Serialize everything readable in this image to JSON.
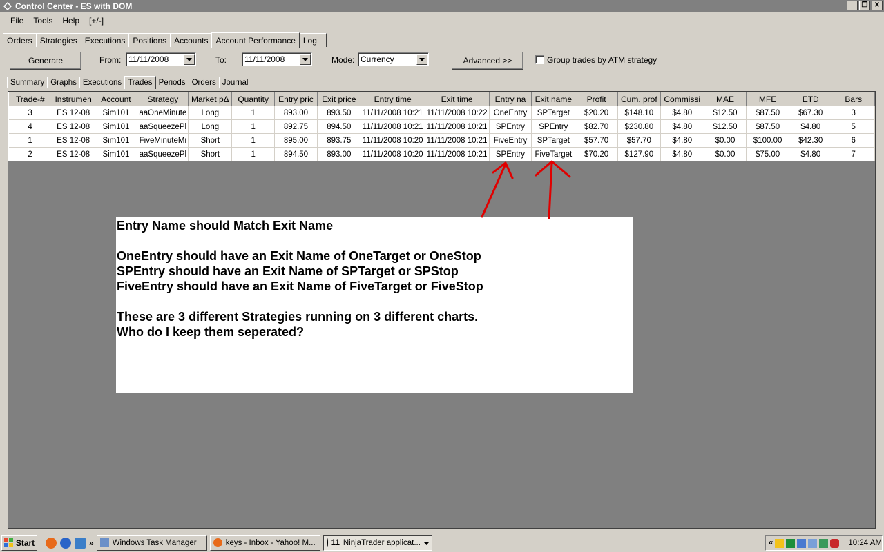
{
  "window": {
    "title": "Control Center - ES with DOM",
    "minimize": "_",
    "restore": "❐",
    "close": "✕"
  },
  "menu": [
    "File",
    "Tools",
    "Help",
    "[+/-]"
  ],
  "main_tabs": [
    "Orders",
    "Strategies",
    "Executions",
    "Positions",
    "Accounts",
    "Account Performance",
    "Log"
  ],
  "toolbar": {
    "generate": "Generate",
    "from_label": "From:",
    "from_value": "11/11/2008",
    "to_label": "To:",
    "to_value": "11/11/2008",
    "mode_label": "Mode:",
    "mode_value": "Currency",
    "advanced": "Advanced >>",
    "group_label": "Group trades by ATM strategy"
  },
  "sub_tabs": [
    "Summary",
    "Graphs",
    "Executions",
    "Trades",
    "Periods",
    "Orders",
    "Journal"
  ],
  "table": {
    "columns": [
      "Trade-#",
      "Instrumen",
      "Account",
      "Strategy",
      "Market pΔ",
      "Quantity",
      "Entry pric",
      "Exit price",
      "Entry time",
      "Exit time",
      "Entry na",
      "Exit name",
      "Profit",
      "Cum. prof",
      "Commissi",
      "MAE",
      "MFE",
      "ETD",
      "Bars"
    ],
    "rows": [
      [
        "3",
        "ES 12-08",
        "Sim101",
        "aaOneMinute",
        "Long",
        "1",
        "893.00",
        "893.50",
        "11/11/2008 10:21",
        "11/11/2008 10:22",
        "OneEntry",
        "SPTarget",
        "$20.20",
        "$148.10",
        "$4.80",
        "$12.50",
        "$87.50",
        "$67.30",
        "3"
      ],
      [
        "4",
        "ES 12-08",
        "Sim101",
        "aaSqueezePl",
        "Long",
        "1",
        "892.75",
        "894.50",
        "11/11/2008 10:21",
        "11/11/2008 10:21",
        "SPEntry",
        "SPEntry",
        "$82.70",
        "$230.80",
        "$4.80",
        "$12.50",
        "$87.50",
        "$4.80",
        "5"
      ],
      [
        "1",
        "ES 12-08",
        "Sim101",
        "FiveMinuteMi",
        "Short",
        "1",
        "895.00",
        "893.75",
        "11/11/2008 10:20",
        "11/11/2008 10:21",
        "FiveEntry",
        "SPTarget",
        "$57.70",
        "$57.70",
        "$4.80",
        "$0.00",
        "$100.00",
        "$42.30",
        "6"
      ],
      [
        "2",
        "ES 12-08",
        "Sim101",
        "aaSqueezePl",
        "Short",
        "1",
        "894.50",
        "893.00",
        "11/11/2008 10:20",
        "11/11/2008 10:21",
        "SPEntry",
        "FiveTarget",
        "$70.20",
        "$127.90",
        "$4.80",
        "$0.00",
        "$75.00",
        "$4.80",
        "7"
      ]
    ]
  },
  "note": {
    "line1": "Entry Name should Match Exit Name",
    "line2": "OneEntry should have an Exit Name of OneTarget or OneStop",
    "line3": "SPEntry should have an Exit Name of SPTarget or SPStop",
    "line4": "FiveEntry should have an Exit Name of FiveTarget or FiveStop",
    "line5": "These are 3 different Strategies running on 3 different charts.",
    "line6": "Who do I keep them seperated?"
  },
  "taskbar": {
    "start": "Start",
    "more": "»",
    "tasks": [
      "Windows Task Manager",
      "keys - Inbox - Yahoo! M...",
      "NinjaTrader applicat..."
    ],
    "ninja_count": "11",
    "tray_chevron": "«",
    "clock": "10:24 AM"
  },
  "colors": {
    "arrow": "#e00000",
    "grid_bg": "#808080",
    "titlebar": "#808080"
  }
}
